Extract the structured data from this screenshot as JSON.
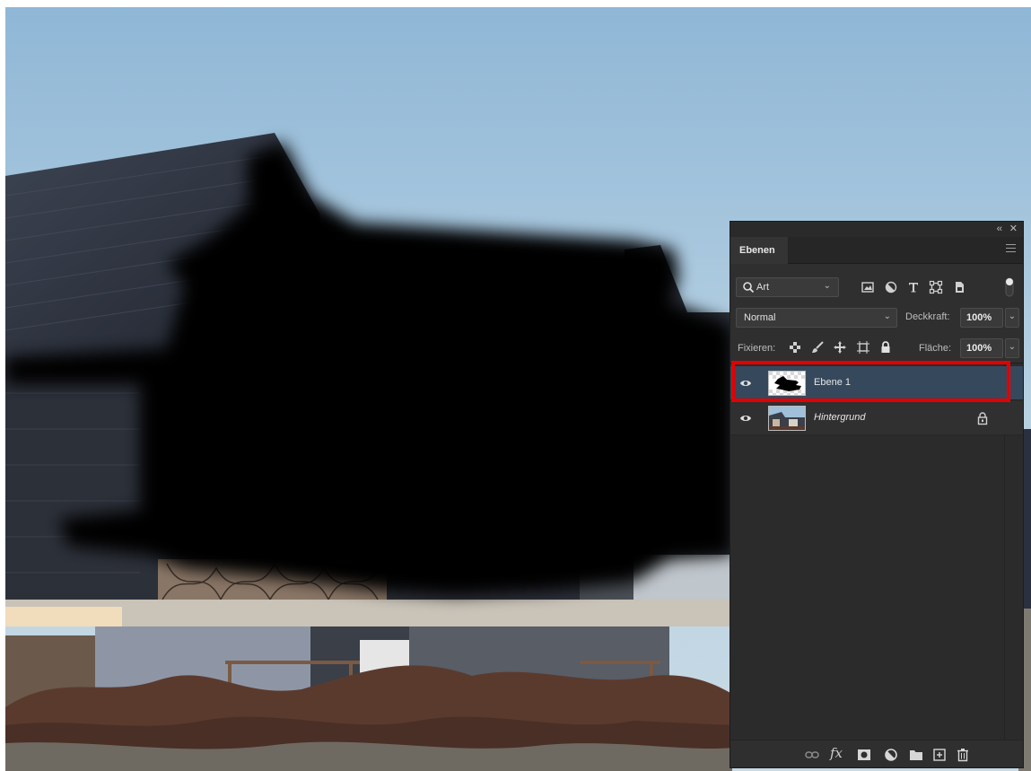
{
  "panel": {
    "collapse_icon": "‹‹",
    "close_icon": "✕",
    "tab_label": "Ebenen",
    "filter": {
      "kind": "Art",
      "chevron": "⌄"
    },
    "blend_mode": "Normal",
    "opacity_label": "Deckkraft:",
    "opacity_value": "100%",
    "lock_label": "Fixieren:",
    "fill_label": "Fläche:",
    "fill_value": "100%",
    "chev": "⌄",
    "layers": [
      {
        "name": "Ebene 1",
        "visible": true,
        "selected": true,
        "italic": false,
        "locked": false
      },
      {
        "name": "Hintergrund",
        "visible": true,
        "selected": false,
        "italic": true,
        "locked": true
      }
    ],
    "highlight_color": "#e40000",
    "selected_color": "#36485c"
  }
}
